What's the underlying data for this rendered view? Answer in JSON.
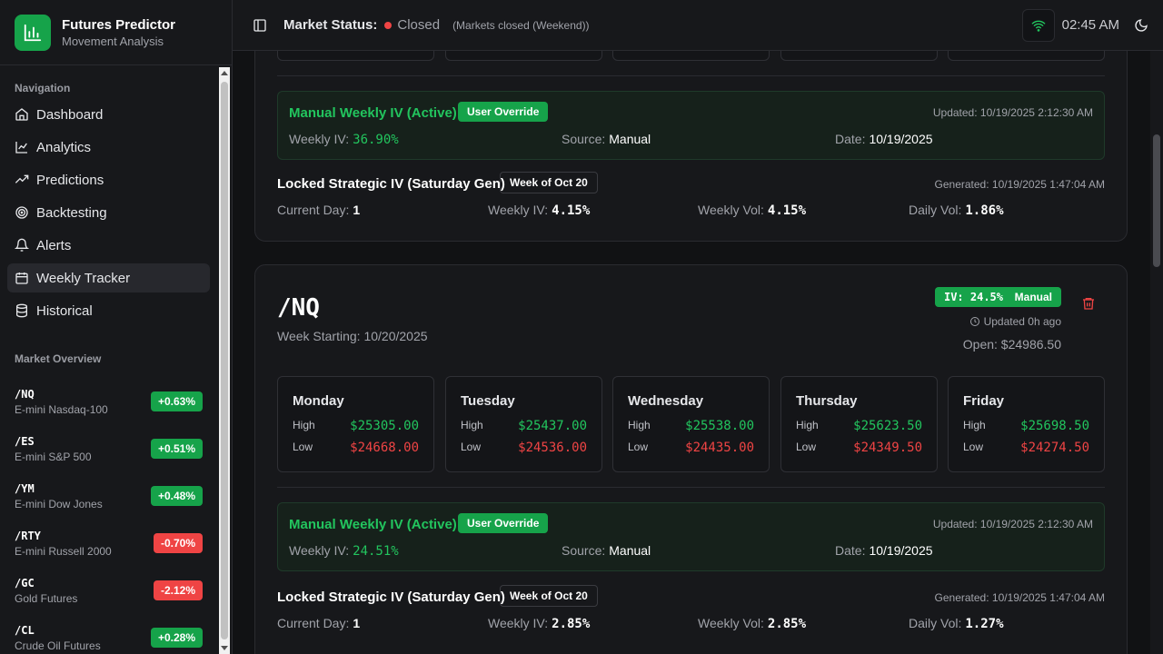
{
  "app": {
    "title": "Futures Predictor",
    "subtitle": "Movement Analysis"
  },
  "sidebar": {
    "nav_label": "Navigation",
    "items": [
      {
        "label": "Dashboard"
      },
      {
        "label": "Analytics"
      },
      {
        "label": "Predictions"
      },
      {
        "label": "Backtesting"
      },
      {
        "label": "Alerts"
      },
      {
        "label": "Weekly Tracker"
      },
      {
        "label": "Historical"
      }
    ],
    "market_label": "Market Overview",
    "markets": [
      {
        "symbol": "/NQ",
        "name": "E-mini Nasdaq-100",
        "change": "+0.63%"
      },
      {
        "symbol": "/ES",
        "name": "E-mini S&P 500",
        "change": "+0.51%"
      },
      {
        "symbol": "/YM",
        "name": "E-mini Dow Jones",
        "change": "+0.48%"
      },
      {
        "symbol": "/RTY",
        "name": "E-mini Russell 2000",
        "change": "-0.70%"
      },
      {
        "symbol": "/GC",
        "name": "Gold Futures",
        "change": "-2.12%"
      },
      {
        "symbol": "/CL",
        "name": "Crude Oil Futures",
        "change": "+0.28%"
      }
    ]
  },
  "header": {
    "market_status_label": "Market Status:",
    "market_status_value": "Closed",
    "market_status_note": "(Markets closed (Weekend))",
    "time": "02:45 AM"
  },
  "card1": {
    "manual": {
      "title": "Manual Weekly IV (Active)",
      "badge": "User Override",
      "updated": "Updated: 10/19/2025 2:12:30 AM",
      "weekly_iv_label": "Weekly IV:",
      "weekly_iv": "36.90%",
      "source_label": "Source:",
      "source": "Manual",
      "date_label": "Date:",
      "date": "10/19/2025"
    },
    "locked": {
      "title": "Locked Strategic IV (Saturday Gen)",
      "badge": "Week of Oct 20",
      "generated": "Generated: 10/19/2025 1:47:04 AM",
      "current_day_label": "Current Day:",
      "current_day": "1",
      "weekly_iv_label": "Weekly IV:",
      "weekly_iv": "4.15%",
      "weekly_vol_label": "Weekly Vol:",
      "weekly_vol": "4.15%",
      "daily_vol_label": "Daily Vol:",
      "daily_vol": "1.86%"
    }
  },
  "card2": {
    "symbol": "/NQ",
    "week_starting": "Week Starting: 10/20/2025",
    "iv_badge": "IV: 24.5%",
    "manual_badge": "Manual",
    "updated_ago": "Updated 0h ago",
    "open": "Open: $24986.50",
    "high_label": "High",
    "low_label": "Low",
    "days": [
      {
        "name": "Monday",
        "high": "$25305.00",
        "low": "$24668.00"
      },
      {
        "name": "Tuesday",
        "high": "$25437.00",
        "low": "$24536.00"
      },
      {
        "name": "Wednesday",
        "high": "$25538.00",
        "low": "$24435.00"
      },
      {
        "name": "Thursday",
        "high": "$25623.50",
        "low": "$24349.50"
      },
      {
        "name": "Friday",
        "high": "$25698.50",
        "low": "$24274.50"
      }
    ],
    "manual": {
      "title": "Manual Weekly IV (Active)",
      "badge": "User Override",
      "updated": "Updated: 10/19/2025 2:12:30 AM",
      "weekly_iv_label": "Weekly IV:",
      "weekly_iv": "24.51%",
      "source_label": "Source:",
      "source": "Manual",
      "date_label": "Date:",
      "date": "10/19/2025"
    },
    "locked": {
      "title": "Locked Strategic IV (Saturday Gen)",
      "badge": "Week of Oct 20",
      "generated": "Generated: 10/19/2025 1:47:04 AM",
      "current_day_label": "Current Day:",
      "current_day": "1",
      "weekly_iv_label": "Weekly IV:",
      "weekly_iv": "2.85%",
      "weekly_vol_label": "Weekly Vol:",
      "weekly_vol": "2.85%",
      "daily_vol_label": "Daily Vol:",
      "daily_vol": "1.27%"
    }
  },
  "colors": {
    "accent": "#16a34a",
    "danger": "#ef4444",
    "bg": "#111214",
    "panel": "#17181b"
  }
}
